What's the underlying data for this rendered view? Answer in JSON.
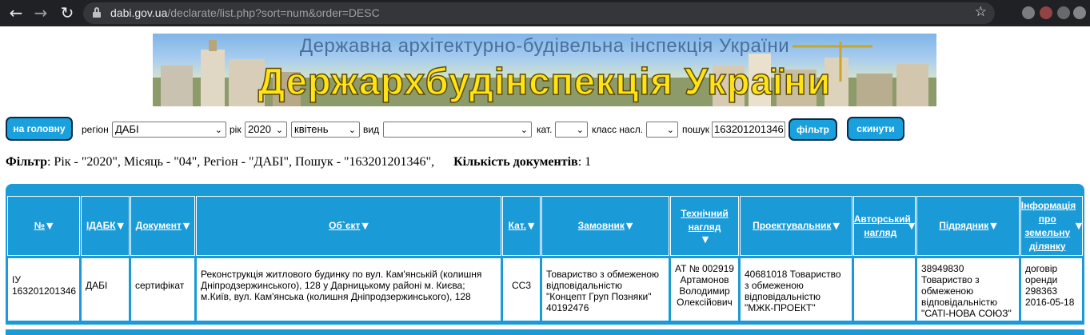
{
  "browser": {
    "url_host": "dabi.gov.ua",
    "url_path": "/declarate/list.php?sort=num&order=DESC"
  },
  "banner": {
    "subtitle": "Державна архітектурно-будівельна інспекція України",
    "title": "Держархбудінспекція України"
  },
  "controls": {
    "home_button": "на головну",
    "region_label": "регіон",
    "region_value": "ДАБІ",
    "year_label": "рік",
    "year_value": "2020",
    "month_value": "квітень",
    "type_label": "вид",
    "type_value": "",
    "cat_label": "кат.",
    "cat_value": "",
    "class_label": "класс насл.",
    "class_value": "",
    "search_label": "пошук",
    "search_value": "163201201346",
    "filter_button": "фільтр",
    "reset_button": "скинути"
  },
  "filter_summary": {
    "filter_label": "Фільтр",
    "filter_text": ": Рік - \"2020\", Місяць - \"04\", Регіон - \"ДАБІ\", Пошук - \"163201201346\",",
    "count_label": "Кількість документів",
    "count_text": ": 1"
  },
  "table": {
    "headers": [
      "№",
      "ІДАБК",
      "Документ",
      "Об`єкт",
      "Кат.",
      "Замовник",
      "Технічний нагляд",
      "Проектувальник",
      "Авторський нагляд",
      "Підрядник",
      "Інформація про земельну ділянку"
    ],
    "rows": [
      {
        "num": "ІУ 163201201346",
        "idabk": "ДАБІ",
        "document": "сертифікат",
        "object": "Реконструкція житлового будинку по вул. Кам'янській (колишня Дніпродзержинського), 128 у Дарницькому районі м. Києва; м.Київ, вул. Кам'янська (колишня Дніпродзержинського), 128",
        "cat": "СС3",
        "customer": "Товариство з обмеженою відповідальністю \"Концепт Груп Позняки\" 40192476",
        "tech_supervision": "АТ № 002919 Артамонов Володимир Олексійович",
        "designer": "40681018 Товариство з обмеженою відповідальністю \"МЖК-ПРОЕКТ\"",
        "author_supervision": "",
        "contractor": "38949830 Товариство з обмеженою відповідальністю \"САТІ-НОВА СОЮЗ\"",
        "land_info": "договір оренди 298363 2016-05-18"
      }
    ]
  },
  "colors": {
    "accent": "#1a9ad6",
    "browser_bar": "#202124"
  },
  "icons": {
    "back": "back-arrow-icon",
    "forward": "forward-arrow-icon",
    "reload": "reload-icon",
    "lock": "lock-icon",
    "bookmark": "star-icon",
    "sort": "sort-triangle-icon",
    "dropdown": "chevron-down-icon"
  }
}
